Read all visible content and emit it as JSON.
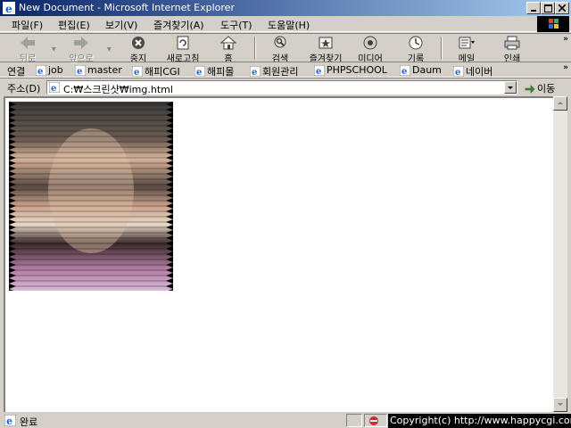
{
  "window": {
    "title": "New Document - Microsoft Internet Explorer"
  },
  "menu": [
    "파일(F)",
    "편집(E)",
    "보기(V)",
    "즐겨찾기(A)",
    "도구(T)",
    "도움말(H)"
  ],
  "toolbar": {
    "back": "뒤로",
    "forward": "앞으로",
    "stop": "중지",
    "refresh": "새로고침",
    "home": "홈",
    "search": "검색",
    "favorites": "즐겨찾기",
    "media": "미디어",
    "history": "기록",
    "mail": "메일",
    "print": "인쇄"
  },
  "links": {
    "label": "연결",
    "items": [
      "job",
      "master",
      "해피CGI",
      "해피몰",
      "회원관리",
      "PHPSCHOOL",
      "Daum",
      "네이버"
    ]
  },
  "address": {
    "label": "주소(D)",
    "value": "C:₩스크린샷₩img.html",
    "go": "이동"
  },
  "status": {
    "text": "완료"
  },
  "watermark": "Copyright(c) http://www.happycgi.com"
}
